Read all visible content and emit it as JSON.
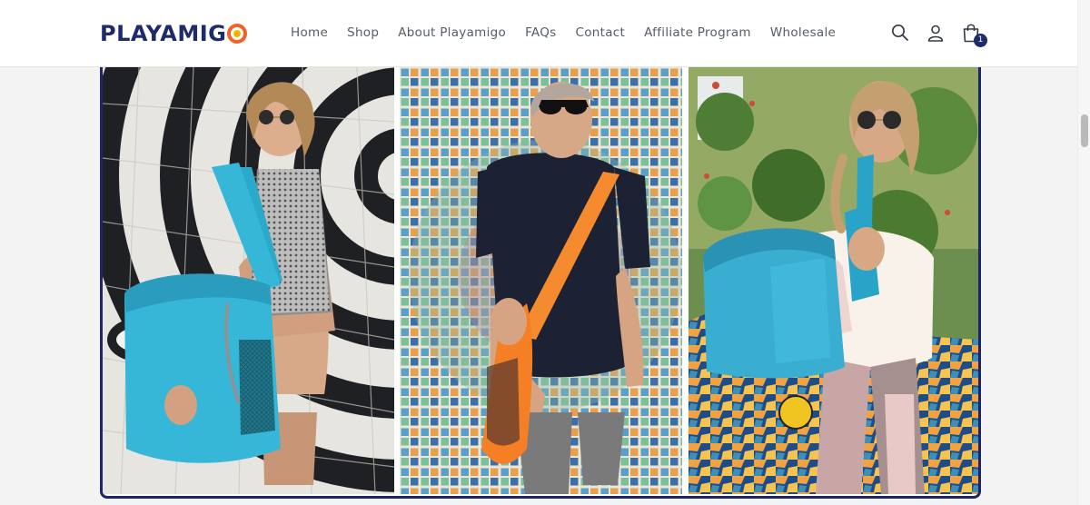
{
  "brand": {
    "logo_text_a": "PLAYAMIG",
    "logo_alt": "Playamigo"
  },
  "nav": {
    "items": [
      "Home",
      "Shop",
      "About Playamigo",
      "FAQs",
      "Contact",
      "Affiliate Program",
      "Wholesale"
    ]
  },
  "header_icons": {
    "search": "search-icon",
    "account": "user-icon",
    "cart": "shopping-bag-icon",
    "cart_count": "1"
  },
  "gallery": {
    "photos": [
      {
        "name": "woman-with-turquoise-tote-mosaic",
        "bag_color": "#35b6d6"
      },
      {
        "name": "man-with-orange-shoulder-bag-mosaic",
        "bag_color": "#f57f25"
      },
      {
        "name": "woman-with-turquoise-backpack-garden",
        "bag_color": "#3aaed0"
      }
    ],
    "frame_color": "#1d2666"
  },
  "colors": {
    "brand_navy": "#1d2a6b",
    "brand_orange": "#f0622a"
  }
}
